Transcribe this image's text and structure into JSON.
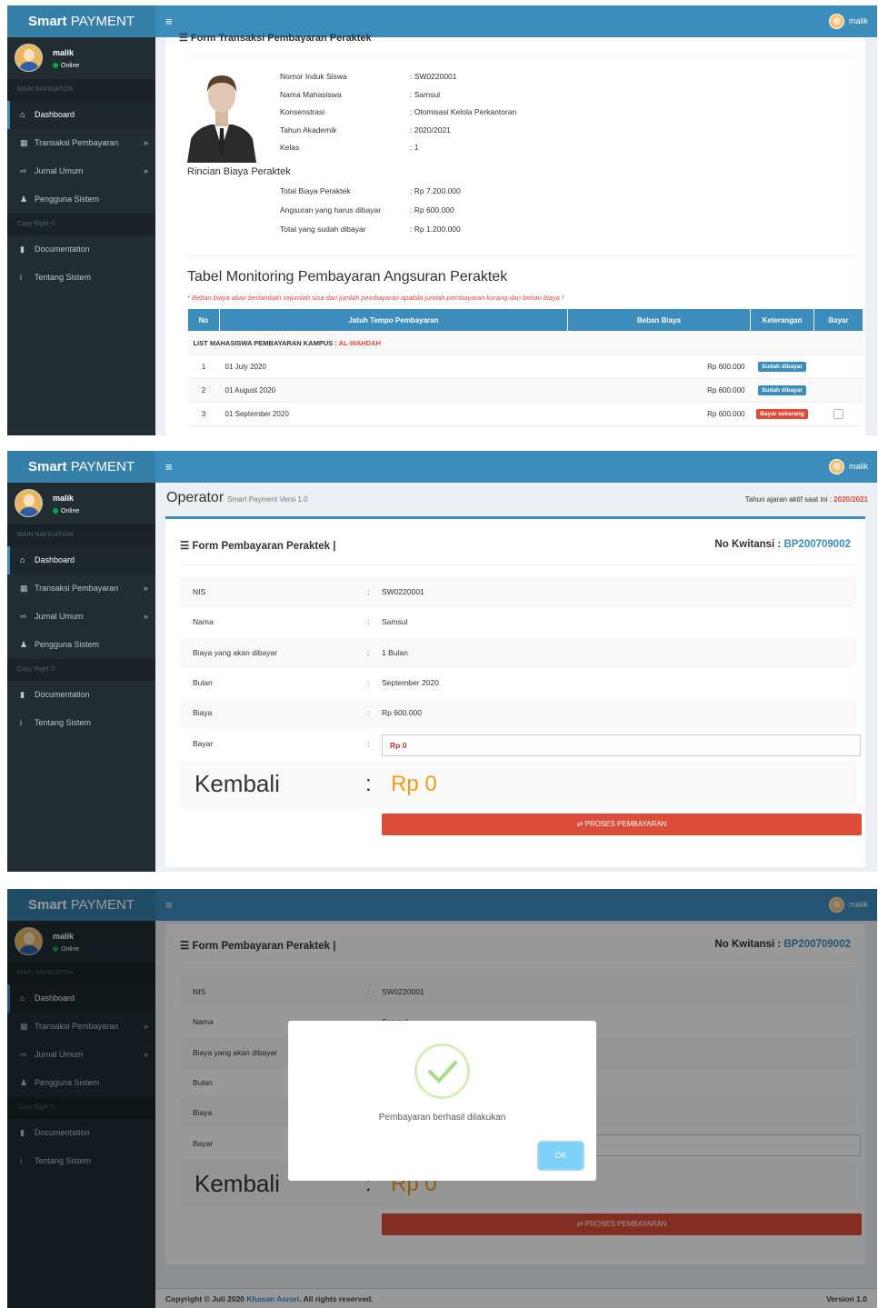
{
  "app": {
    "logo_bold": "Smart",
    "logo_rest": " PAYMENT",
    "menu_icon": "≡",
    "user": "malik"
  },
  "sidebar": {
    "user_name": "malik",
    "status": "Online",
    "main_nav": "MAIN NAVIGATION",
    "copyright_head": "Copy Right ©",
    "items": [
      {
        "label": "Dashboard",
        "icon": "home-icon",
        "glyph": "⌂"
      },
      {
        "label": "Transaksi Pembayaran",
        "icon": "calculator-icon",
        "glyph": "▦"
      },
      {
        "label": "Jurnal Umum",
        "icon": "sign-in-icon",
        "glyph": "⇨"
      },
      {
        "label": "Pengguna Sistem",
        "icon": "user-plus-icon",
        "glyph": "♟"
      }
    ],
    "items2": [
      {
        "label": "Documentation",
        "icon": "book-icon",
        "glyph": "▮"
      },
      {
        "label": "Tentang Sistem",
        "icon": "info-icon",
        "glyph": "i"
      }
    ],
    "chevron": "»"
  },
  "panel1": {
    "clipped_title": "Form Transaksi Pembayaran Peraktek",
    "student": [
      {
        "k": "Nomor Induk Siswa",
        "v": ": SW0220001"
      },
      {
        "k": "Nama Mahasiswa",
        "v": ": Samsul"
      },
      {
        "k": "Konsenstrasi",
        "v": ": Otomisasi Kelola Perkantoran"
      },
      {
        "k": "Tahun Akademik",
        "v": ": 2020/2021"
      },
      {
        "k": "Kelas",
        "v": ": 1"
      }
    ],
    "rincian_title": "Rincian Biaya Peraktek",
    "rincian": [
      {
        "k": "Total Biaya Peraktek",
        "v": ": Rp 7.200.000"
      },
      {
        "k": "Angsuran yang harus dibayar",
        "v": ": Rp 600.000"
      },
      {
        "k": "Total yang sudah dibayar",
        "v": ": Rp 1.200.000"
      }
    ],
    "table_title": "Tabel Monitoring Pembayaran Angsuran Peraktek",
    "note": "* Beban biaya akan bertambah sejumlah sisa dari jumlah pembayaran apabila jumlah pembayaran kurang dari beban biaya !",
    "headers": [
      "No",
      "Jatuh Tempo Pembayaran",
      "Beban Biaya",
      "Keterangan",
      "Bayar"
    ],
    "group_label": "LIST MAHASISWA PEMBAYARAN KAMPUS : ",
    "group_name": "AL-WAHDAH",
    "rows": [
      {
        "no": "1",
        "date": "01 July 2020",
        "amount": "Rp 600.000",
        "status": "Sudah dibayar",
        "color": "#3c8dbc",
        "check": false
      },
      {
        "no": "2",
        "date": "01 August 2020",
        "amount": "Rp 600.000",
        "status": "Sudah dibayar",
        "color": "#3c8dbc",
        "check": false
      },
      {
        "no": "3",
        "date": "01 September 2020",
        "amount": "Rp 600.000",
        "status": "Bayar sekarang",
        "color": "#dd4b39",
        "check": true
      }
    ]
  },
  "form": {
    "page_title": "Operator",
    "page_subtitle": "Smart Payment Versi 1.0",
    "tahun_label": "Tahun ajaran aktif saat ini : ",
    "tahun_value": "2020/2021",
    "title": "Form Pembayaran Peraktek |",
    "kwitansi_label": "No Kwitansi : ",
    "kwitansi_value": "BP200709002",
    "rows": [
      {
        "label": "NIS",
        "value": "SW0220001"
      },
      {
        "label": "Nama",
        "value": "Samsul"
      },
      {
        "label": "Biaya yang akan dibayar",
        "value": "1 Bulan"
      },
      {
        "label": "Bulan",
        "value": "September 2020"
      },
      {
        "label": "Biaya",
        "value": "Rp 600.000"
      }
    ],
    "bayar_label": "Bayar",
    "bayar_value": "Rp 0",
    "colon": ":",
    "kembali_label": "Kembali",
    "kembali_value": "Rp 0",
    "button": "⇄ PROSES PEMBAYARAN"
  },
  "modal": {
    "message": "Pembayaran berhasil dilakukan",
    "ok": "OK"
  },
  "footer": {
    "prefix": "Copyright © Juli 2020 ",
    "author": "Khasan Asrori",
    "suffix": ". All rights reserved.",
    "version": "Version 1.0"
  }
}
